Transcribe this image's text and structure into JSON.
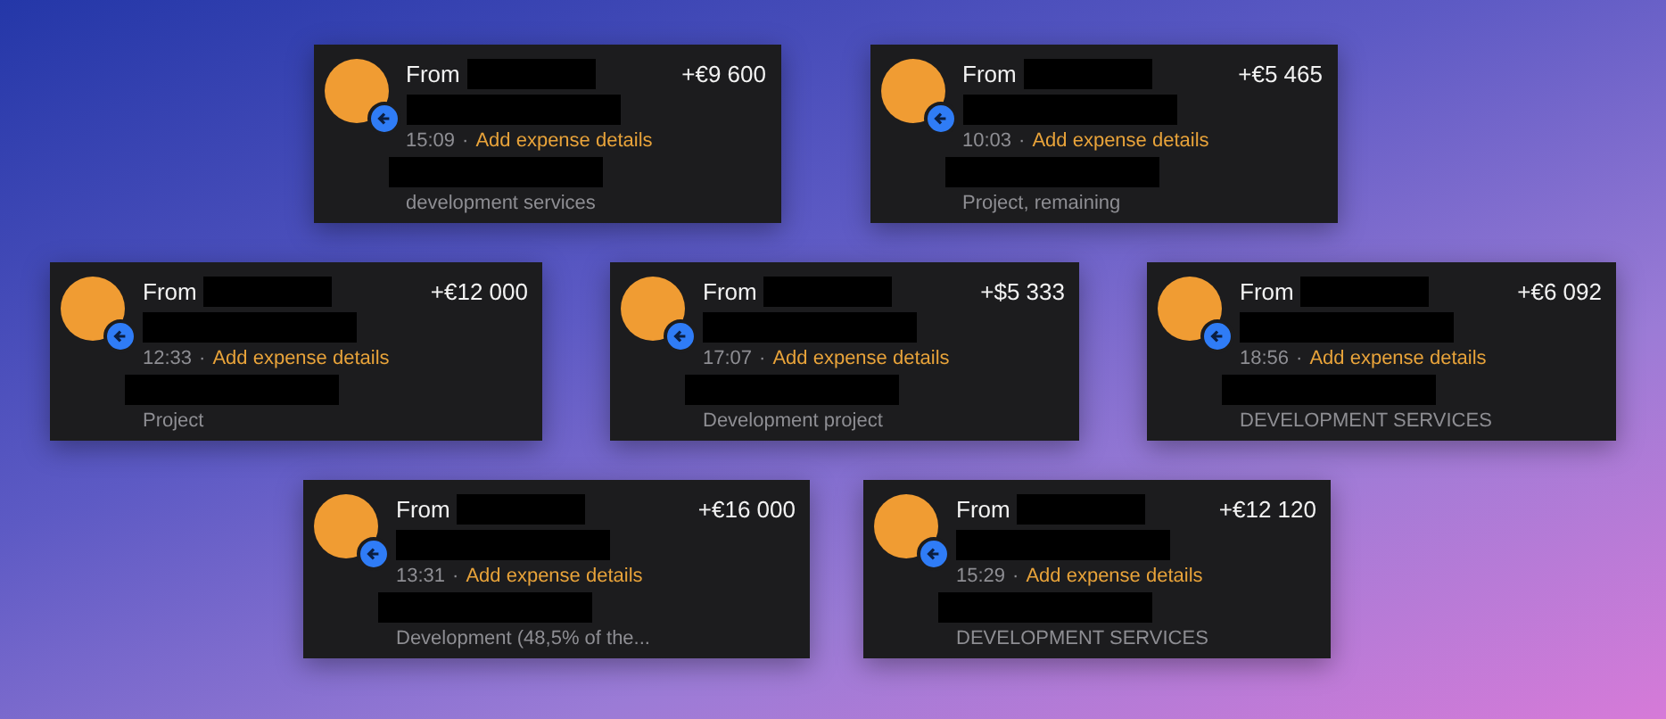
{
  "rows": [
    {
      "cards": [
        {
          "from": "From",
          "amount": "+€9 600",
          "time": "15:09",
          "separator": "·",
          "link": "Add expense details",
          "note": "development services"
        },
        {
          "from": "From",
          "amount": "+€5 465",
          "time": "10:03",
          "separator": "·",
          "link": "Add expense details",
          "note": "Project, remaining"
        }
      ]
    },
    {
      "cards": [
        {
          "from": "From",
          "amount": "+€12 000",
          "time": "12:33",
          "separator": "·",
          "link": "Add expense details",
          "note": "Project"
        },
        {
          "from": "From",
          "amount": "+$5 333",
          "time": "17:07",
          "separator": "·",
          "link": "Add expense details",
          "note": "Development project"
        },
        {
          "from": "From",
          "amount": "+€6 092",
          "time": "18:56",
          "separator": "·",
          "link": "Add expense details",
          "note": "DEVELOPMENT SERVICES"
        }
      ]
    },
    {
      "cards": [
        {
          "from": "From",
          "amount": "+€16 000",
          "time": "13:31",
          "separator": "·",
          "link": "Add expense details",
          "note": "Development (48,5% of the..."
        },
        {
          "from": "From",
          "amount": "+€12 120",
          "time": "15:29",
          "separator": "·",
          "link": "Add expense details",
          "note": "DEVELOPMENT SERVICES"
        }
      ]
    }
  ]
}
